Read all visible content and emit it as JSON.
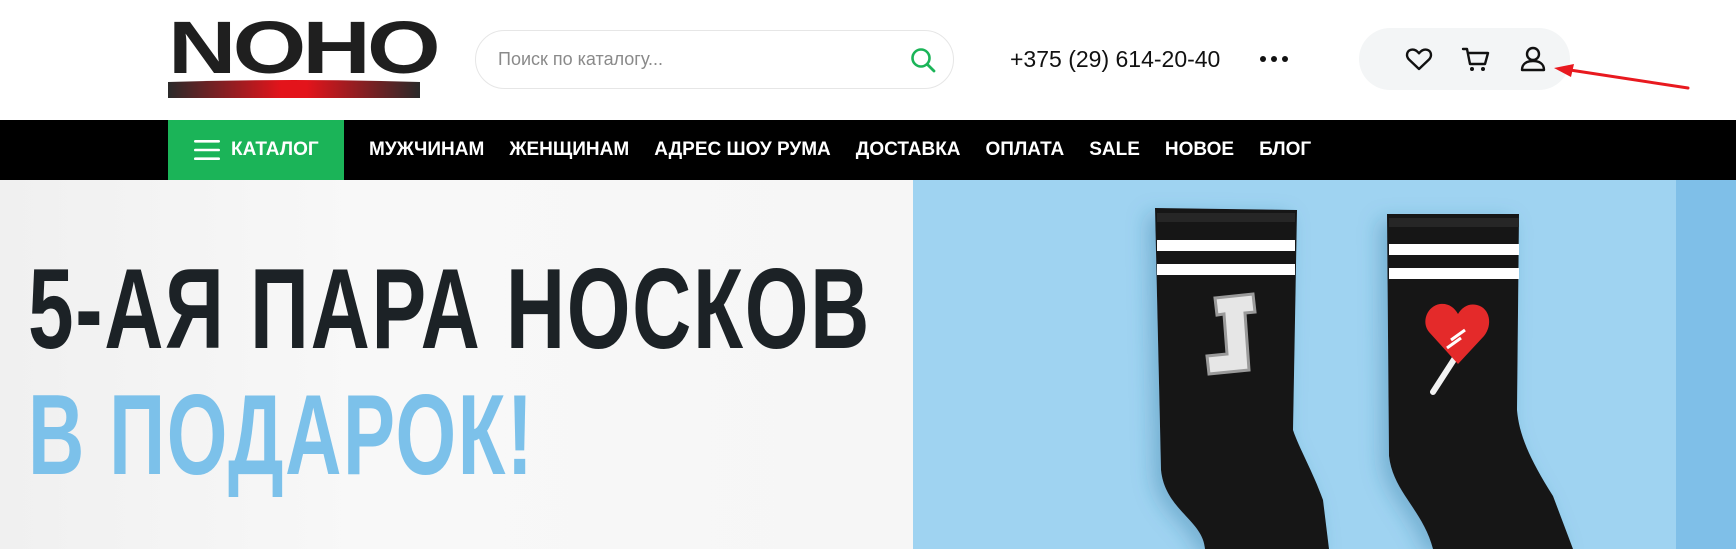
{
  "header": {
    "logo_text": "NOHO",
    "search": {
      "placeholder": "Поиск по каталогу...",
      "value": ""
    },
    "phone": "+375 (29) 614-20-40",
    "icons": [
      "search-icon",
      "more-icon",
      "heart-icon",
      "cart-icon",
      "user-icon"
    ]
  },
  "nav": {
    "catalog_label": "КАТАЛОГ",
    "items": [
      "МУЖЧИНАМ",
      "ЖЕНЩИНАМ",
      "АДРЕС ШОУ РУМА",
      "ДОСТАВКА",
      "ОПЛАТА",
      "SALE",
      "НОВОЕ",
      "БЛОГ"
    ]
  },
  "banner": {
    "line1": "5-АЯ ПАРА НОСКОВ",
    "line2": "В ПОДАРОК!"
  },
  "colors": {
    "accent_green": "#1bb458",
    "nav_bg": "#000000",
    "headline_dark": "#1c2226",
    "headline_blue": "#7cc1ea",
    "banner_blue": "#9fd3f1",
    "annotation_red": "#e8191f"
  }
}
